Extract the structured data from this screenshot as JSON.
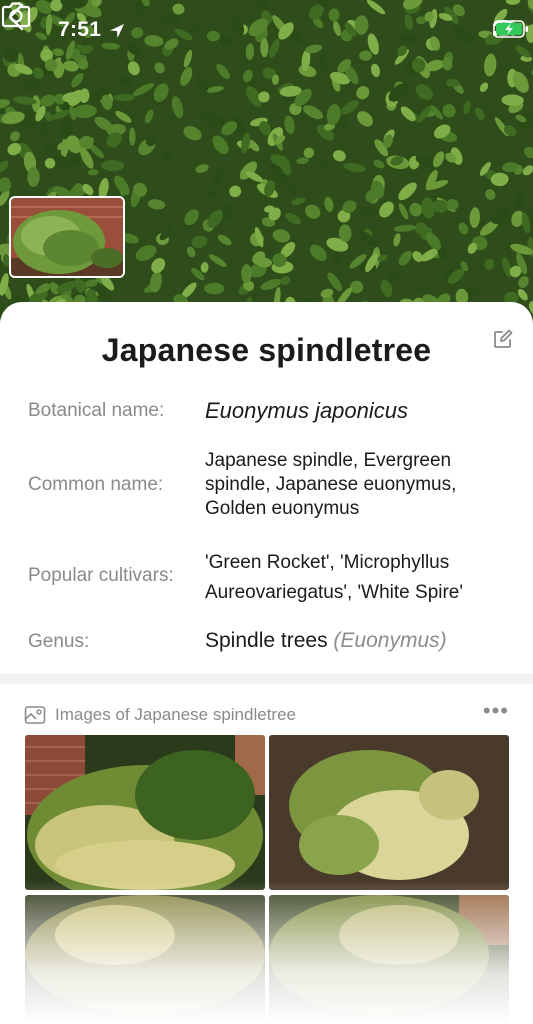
{
  "status_bar": {
    "time": "7:51"
  },
  "plant": {
    "title": "Japanese spindletree",
    "fields": [
      {
        "label": "Botanical name:",
        "value": "Euonymus japonicus"
      },
      {
        "label": "Common name:",
        "value": "Japanese spindle, Evergreen spindle, Japanese euonymus, Golden euonymus"
      },
      {
        "label": "Popular cultivars:",
        "value": "'Green Rocket', 'Microphyllus Aureovariegatus', 'White Spire'"
      },
      {
        "label": "Genus:",
        "value": "Spindle trees",
        "value_secondary": "(Euonymus)"
      }
    ]
  },
  "images_section": {
    "title": "Images of Japanese spindletree",
    "more": "•••"
  },
  "icons": [
    "location-arrow-icon",
    "signal-icon",
    "wifi-icon",
    "battery-charging-icon",
    "back-chevron-icon",
    "camera-icon",
    "edit-icon",
    "gallery-icon",
    "more-icon"
  ],
  "colors": {
    "label": "#8a8a8a",
    "text": "#1b1b1b",
    "hedge": "#2f4d1a",
    "battery": "#34c759"
  }
}
